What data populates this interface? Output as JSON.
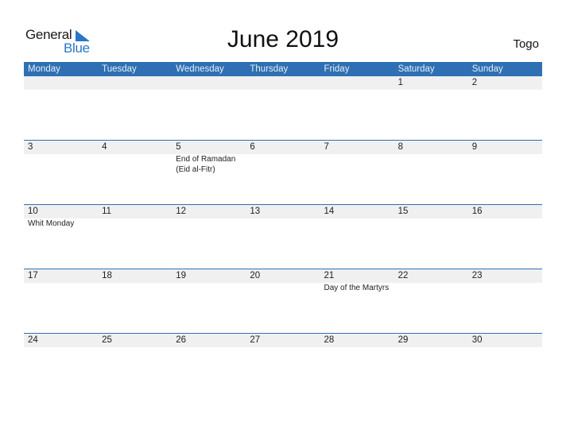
{
  "logo": {
    "line1": "General",
    "line2": "Blue"
  },
  "title": "June 2019",
  "country": "Togo",
  "colors": {
    "accent": "#2e70b3",
    "band": "#f0f0f0",
    "logo_blue": "#2a77c6"
  },
  "weekdays": [
    "Monday",
    "Tuesday",
    "Wednesday",
    "Thursday",
    "Friday",
    "Saturday",
    "Sunday"
  ],
  "weeks": [
    {
      "days": [
        {
          "num": "",
          "event": ""
        },
        {
          "num": "",
          "event": ""
        },
        {
          "num": "",
          "event": ""
        },
        {
          "num": "",
          "event": ""
        },
        {
          "num": "",
          "event": ""
        },
        {
          "num": "1",
          "event": ""
        },
        {
          "num": "2",
          "event": ""
        }
      ]
    },
    {
      "days": [
        {
          "num": "3",
          "event": ""
        },
        {
          "num": "4",
          "event": ""
        },
        {
          "num": "5",
          "event": "End of Ramadan (Eid al-Fitr)"
        },
        {
          "num": "6",
          "event": ""
        },
        {
          "num": "7",
          "event": ""
        },
        {
          "num": "8",
          "event": ""
        },
        {
          "num": "9",
          "event": ""
        }
      ]
    },
    {
      "days": [
        {
          "num": "10",
          "event": "Whit Monday"
        },
        {
          "num": "11",
          "event": ""
        },
        {
          "num": "12",
          "event": ""
        },
        {
          "num": "13",
          "event": ""
        },
        {
          "num": "14",
          "event": ""
        },
        {
          "num": "15",
          "event": ""
        },
        {
          "num": "16",
          "event": ""
        }
      ]
    },
    {
      "days": [
        {
          "num": "17",
          "event": ""
        },
        {
          "num": "18",
          "event": ""
        },
        {
          "num": "19",
          "event": ""
        },
        {
          "num": "20",
          "event": ""
        },
        {
          "num": "21",
          "event": "Day of the Martyrs"
        },
        {
          "num": "22",
          "event": ""
        },
        {
          "num": "23",
          "event": ""
        }
      ]
    },
    {
      "days": [
        {
          "num": "24",
          "event": ""
        },
        {
          "num": "25",
          "event": ""
        },
        {
          "num": "26",
          "event": ""
        },
        {
          "num": "27",
          "event": ""
        },
        {
          "num": "28",
          "event": ""
        },
        {
          "num": "29",
          "event": ""
        },
        {
          "num": "30",
          "event": ""
        }
      ]
    }
  ]
}
